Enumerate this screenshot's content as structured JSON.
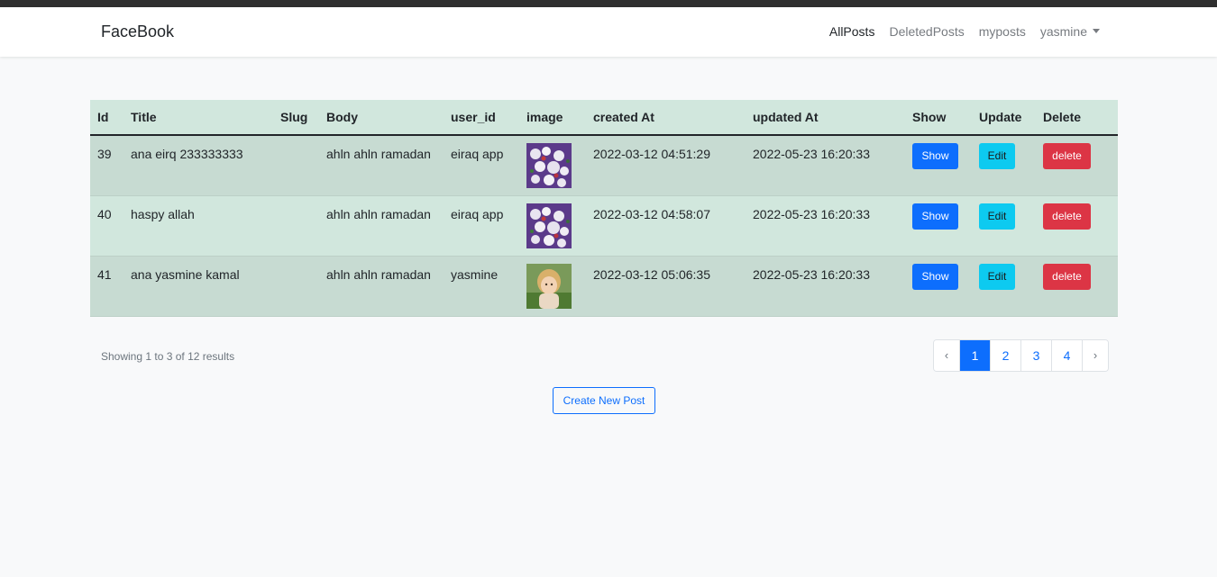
{
  "navbar": {
    "brand": "FaceBook",
    "links": [
      {
        "label": "AllPosts",
        "active": true
      },
      {
        "label": "DeletedPosts",
        "active": false
      },
      {
        "label": "myposts",
        "active": false
      },
      {
        "label": "yasmine",
        "active": false
      }
    ]
  },
  "table": {
    "headers": [
      "Id",
      "Title",
      "Slug",
      "Body",
      "user_id",
      "image",
      "created At",
      "updated At",
      "Show",
      "Update",
      "Delete"
    ],
    "rows": [
      {
        "id": "39",
        "title": "ana eirq 233333333",
        "slug": "",
        "body": "ahln ahln ramadan",
        "user_id": "eiraq app",
        "image": "flowers-thumbnail",
        "created_at": "2022-03-12 04:51:29",
        "updated_at": "2022-05-23 16:20:33",
        "show_label": "Show",
        "edit_label": "Edit",
        "delete_label": "delete"
      },
      {
        "id": "40",
        "title": "haspy allah",
        "slug": "",
        "body": "ahln ahln ramadan",
        "user_id": "eiraq app",
        "image": "flowers-thumbnail",
        "created_at": "2022-03-12 04:58:07",
        "updated_at": "2022-05-23 16:20:33",
        "show_label": "Show",
        "edit_label": "Edit",
        "delete_label": "delete"
      },
      {
        "id": "41",
        "title": "ana yasmine kamal",
        "slug": "",
        "body": "ahln ahln ramadan",
        "user_id": "yasmine",
        "image": "girl-thumbnail",
        "created_at": "2022-03-12 05:06:35",
        "updated_at": "2022-05-23 16:20:33",
        "show_label": "Show",
        "edit_label": "Edit",
        "delete_label": "delete"
      }
    ]
  },
  "pagination": {
    "summary": "Showing 1 to 3 of 12 results",
    "prev": "‹",
    "pages": [
      "1",
      "2",
      "3",
      "4"
    ],
    "current": "1",
    "next": "›"
  },
  "create_button": "Create New Post",
  "colors": {
    "primary": "#0d6efd",
    "info": "#0dcaf0",
    "danger": "#dc3545",
    "table_bg": "#d1e7dd"
  }
}
